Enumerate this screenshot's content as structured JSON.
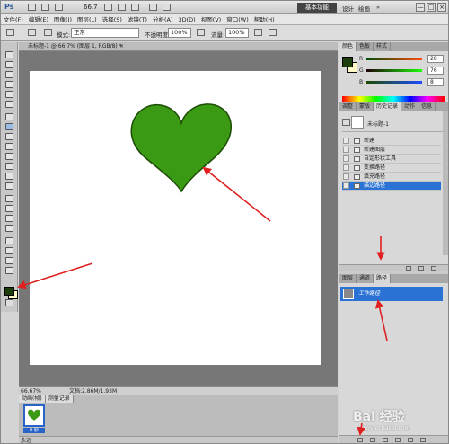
{
  "titlebar": {
    "logo": "Ps",
    "zoom": "66.7",
    "workspace_active": "基本功能",
    "workspace_links": [
      "设计",
      "绘画"
    ],
    "extra_link": "»",
    "window_buttons": [
      "—",
      "□",
      "×"
    ]
  },
  "menu": [
    "文件(F)",
    "编辑(E)",
    "图像(I)",
    "图层(L)",
    "选择(S)",
    "滤镜(T)",
    "分析(A)",
    "3D(D)",
    "视图(V)",
    "窗口(W)",
    "帮助(H)"
  ],
  "options": {
    "mode_label": "模式:",
    "mode_value": "正常",
    "opacity_label": "不透明度:",
    "opacity_value": "100%",
    "flow_label": "流量:",
    "flow_value": "100%"
  },
  "document": {
    "tab_title": "未标题-1 @ 66.7% (图层 1, RGB/8) *",
    "tab_close": "×",
    "status_zoom": "66.67%",
    "status_doc": "文档:2.86M/1.93M"
  },
  "bottom_panel": {
    "tabs": [
      "动画(帧)",
      "测量记录"
    ],
    "frame_label": "0 秒",
    "footer_loop": "永远"
  },
  "color_panel": {
    "tabs": [
      "颜色",
      "色板",
      "样式"
    ],
    "active_tab": "颜色",
    "foreground_color": "#1c3d0c",
    "background_color": "#fff9c8",
    "channels": [
      {
        "label": "R",
        "value": "28"
      },
      {
        "label": "G",
        "value": "76"
      },
      {
        "label": "B",
        "value": "8"
      }
    ]
  },
  "history_panel": {
    "tabs": [
      "调整",
      "蒙版",
      "历史记录",
      "动作",
      "信息"
    ],
    "active_tab": "历史记录",
    "snapshot_name": "未标题-1",
    "items": [
      "新建",
      "新建图层",
      "自定形状工具",
      "变换路径",
      "填充路径",
      "描边路径"
    ],
    "selected_item": "描边路径"
  },
  "paths_panel": {
    "tabs": [
      "图层",
      "通道",
      "路径"
    ],
    "active_tab": "路径",
    "path_name": "工作路径"
  },
  "watermark": {
    "text": "Bai 经验",
    "sub": "jingyan.baidu.com"
  },
  "colors": {
    "heart_fill": "#3a9a14",
    "arrow": "#e02020",
    "selection_blue": "#2a72d4"
  }
}
